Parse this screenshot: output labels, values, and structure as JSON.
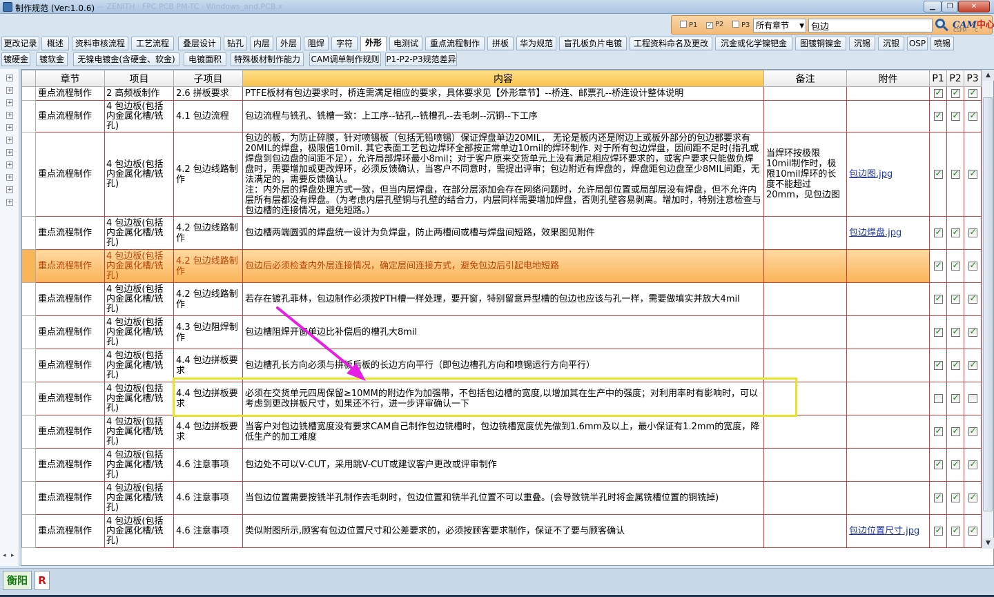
{
  "window": {
    "title": "制作规范 (Ver:1.0.6)",
    "ghost_text": "— ZENITH · FPC PCB PM-TC · Windows_and.PCB.x",
    "min_icon": "minimize-icon",
    "max_icon": "maximize-icon",
    "close_icon": "close-icon"
  },
  "search": {
    "p1_label": "P1",
    "p1_checked": false,
    "p2_label": "P2",
    "p2_checked": true,
    "p3_label": "P3",
    "p3_checked": false,
    "chapter_select": "所有章节",
    "query": "包边",
    "logo_main": "CAM",
    "logo_accent": "中心",
    "logo_sub": "CSPM · · C"
  },
  "tabs_row1": [
    {
      "label": "更改记录"
    },
    {
      "label": "概述"
    },
    {
      "label": "资料审核流程"
    },
    {
      "label": "工艺流程"
    },
    {
      "label": "叠层设计"
    },
    {
      "label": "钻孔"
    },
    {
      "label": "内层"
    },
    {
      "label": "外层"
    },
    {
      "label": "阻焊"
    },
    {
      "label": "字符"
    },
    {
      "label": "外形",
      "active": true
    },
    {
      "label": "电测试"
    },
    {
      "label": "重点流程制作"
    },
    {
      "label": "拼板"
    },
    {
      "label": "华为规范"
    },
    {
      "label": "盲孔板负片电镀"
    },
    {
      "label": "工程资料命名及更改"
    },
    {
      "label": "沉金或化学镍钯金"
    },
    {
      "label": "图镀铜镍金"
    },
    {
      "label": "沉锡"
    },
    {
      "label": "沉银"
    },
    {
      "label": "OSP"
    },
    {
      "label": "喷锡"
    }
  ],
  "tabs_row2": [
    {
      "label": "镀硬金"
    },
    {
      "label": "镀软金"
    },
    {
      "label": "无镍电镀金(含硬金、软金)"
    },
    {
      "label": "电镀面积"
    },
    {
      "label": "特殊板材制作能力"
    },
    {
      "label": "CAM调单制作规则"
    },
    {
      "label": "P1-P2-P3规范差异"
    }
  ],
  "grid": {
    "headers": {
      "chapter": "章节",
      "item": "项目",
      "sub": "子项目",
      "content": "内容",
      "note": "备注",
      "attachment": "附件",
      "p1": "P1",
      "p2": "P2",
      "p3": "P3"
    },
    "rows": [
      {
        "chapter": "重点流程制作",
        "item": "2 高频板制作",
        "sub": "2.6 拼板要求",
        "content": "PTFE板材有包边要求时，桥连需满足相应的要求，具体要求见【外形章节】--桥连、邮票孔--桥连设计整体说明",
        "note": "",
        "attachment": "",
        "p1": true,
        "p2": true,
        "p3": true
      },
      {
        "chapter": "重点流程制作",
        "item": "4 包边板(包括内金属化槽/铣孔)",
        "sub": "4.1 包边流程",
        "content": "包边流程与铣孔、铣槽一致：上工序--钻孔--铣槽孔--去毛刺--沉铜--下工序",
        "note": "",
        "attachment": "",
        "p1": true,
        "p2": true,
        "p3": true
      },
      {
        "chapter": "重点流程制作",
        "item": "4 包边板(包括内金属化槽/铣孔)",
        "sub": "4.2 包边线路制作",
        "content": "包边的板，为防止碎膜，针对喷锡板（包括无铅喷锡）保证焊盘单边20MIL， 无论是板内还是附边上或板外部分的包边都要求有20MIL的焊盘，极限值10mil. 其它表面工艺包边焊环全部按正常单边10mil的焊环制作. 对于所有包边焊盘，因间距不足时(指孔或焊盘到包边盘的间距不足），允许局部焊环最小8mil；对于客户原来交货单元上没有满足相应焊环要求的，或客户要求只能做负焊盘时，需要增加或更改焊环，必须反馈确认，当客户不同意时，需提出评审；包边附近有焊盘的，焊盘距包边盘至少8MIL间距，无法满足的，需要反馈确认。\n注：内外层的焊盘处理方式一致，但当内层焊盘，在部分层添加会存在网络问题时，允许局部位置或局部层没有焊盘，但不允许内层所有层都没有焊盘。（为考虑内层孔壁铜与孔壁的结合力，内层同样需要增加焊盘，否则孔壁容易剥离。增加时，特别注意检查与包边槽的连接情况，避免短路。）",
        "note": "当焊环按极限10mil制作时，极限10mil焊环的长度不能超过20mm，见包边图",
        "attachment": "包边图.jpg",
        "p1": true,
        "p2": true,
        "p3": true
      },
      {
        "chapter": "重点流程制作",
        "item": "4 包边板(包括内金属化槽/铣孔)",
        "sub": "4.2 包边线路制作",
        "content": "包边槽两端圆弧的焊盘统一设计为负焊盘，防止两槽间或槽与焊盘间短路，效果图见附件",
        "note": "",
        "attachment": "包边焊盘.jpg",
        "p1": true,
        "p2": true,
        "p3": true
      },
      {
        "chapter": "重点流程制作",
        "item": "4 包边板(包括内金属化槽/铣孔)",
        "sub": "4.2 包边线路制作",
        "content": "包边后必须检查内外层连接情况，确定层间连接方式，避免包边后引起电地短路",
        "note": "",
        "attachment": "",
        "p1": true,
        "p2": true,
        "p3": true,
        "selected": true
      },
      {
        "chapter": "重点流程制作",
        "item": "4 包边板(包括内金属化槽/铣孔)",
        "sub": "4.2 包边线路制作",
        "content": "若存在镀孔菲林，包边制作必须按PTH槽一样处理，要开窗，特别留意异型槽的包边也应该与孔一样，需要做填实并放大4mil",
        "note": "",
        "attachment": "",
        "p1": true,
        "p2": true,
        "p3": true
      },
      {
        "chapter": "重点流程制作",
        "item": "4 包边板(包括内金属化槽/铣孔)",
        "sub": "4.3 包边阻焊制作",
        "content": "包边槽阻焊开窗单边比补偿后的槽孔大8mil",
        "note": "",
        "attachment": "",
        "p1": true,
        "p2": true,
        "p3": true
      },
      {
        "chapter": "重点流程制作",
        "item": "4 包边板(包括内金属化槽/铣孔)",
        "sub": "4.4 包边拼板要求",
        "content": "包边槽孔长方向必须与拼板后板的长边方向平行（即包边槽孔方向和喷锡运行方向平行）",
        "note": "",
        "attachment": "",
        "p1": true,
        "p2": true,
        "p3": true
      },
      {
        "chapter": "重点流程制作",
        "item": "4 包边板(包括内金属化槽/铣孔)",
        "sub": "4.4 包边拼板要求",
        "content": "必须在交货单元四周保留≥10MM的附边作为加强带，不包括包边槽的宽度,以增加其在生产中的强度；对利用率时有影响时，可以考虑到更改拼板尺寸，如果还不行，进一步评审确认一下",
        "note": "",
        "attachment": "",
        "p1": false,
        "p2": true,
        "p3": false
      },
      {
        "chapter": "重点流程制作",
        "item": "4 包边板(包括内金属化槽/铣孔)",
        "sub": "4.4 包边拼板要求",
        "content": "当客户对包边铣槽宽度没有要求CAM自己制作包边铣槽时，包边铣槽宽度优先做到1.6mm及以上，最小保证有1.2mm的宽度，降低生产的加工难度",
        "note": "",
        "attachment": "",
        "p1": true,
        "p2": true,
        "p3": true
      },
      {
        "chapter": "重点流程制作",
        "item": "4 包边板(包括内金属化槽/铣孔)",
        "sub": "4.6 注意事项",
        "content": "包边处不可以V-CUT，采用跳V-CUT或建议客户更改或评审制作",
        "note": "",
        "attachment": "",
        "p1": true,
        "p2": true,
        "p3": true
      },
      {
        "chapter": "重点流程制作",
        "item": "4 包边板(包括内金属化槽/铣孔)",
        "sub": "4.6 注意事项",
        "content": "当包边位置需要按铣半孔制作去毛刺时，包边位置和铣半孔位置不可以重叠。(会导致铣半孔时将金属铣槽位置的铜铣掉)",
        "note": "",
        "attachment": "",
        "p1": true,
        "p2": true,
        "p3": true
      },
      {
        "chapter": "重点流程制作",
        "item": "4 包边板(包括内金属化槽/铣孔)",
        "sub": "4.6 注意事项",
        "content": "类似附图所示,顾客有包边位置尺寸和公差要求的，必须按顾客要求制作，保证不了要与顾客确认",
        "note": "",
        "attachment": "包边位置尺寸.jpg",
        "p1": true,
        "p2": true,
        "p3": true
      }
    ]
  },
  "status": {
    "location": "衡阳",
    "r_label": "R"
  },
  "colors": {
    "selected_row": "#f9b458",
    "selected_text": "#b8460a",
    "highlight_box": "#e7e22a",
    "arrow": "#e61ee6",
    "grid_border": "#d04040",
    "link": "#1d36a8"
  }
}
